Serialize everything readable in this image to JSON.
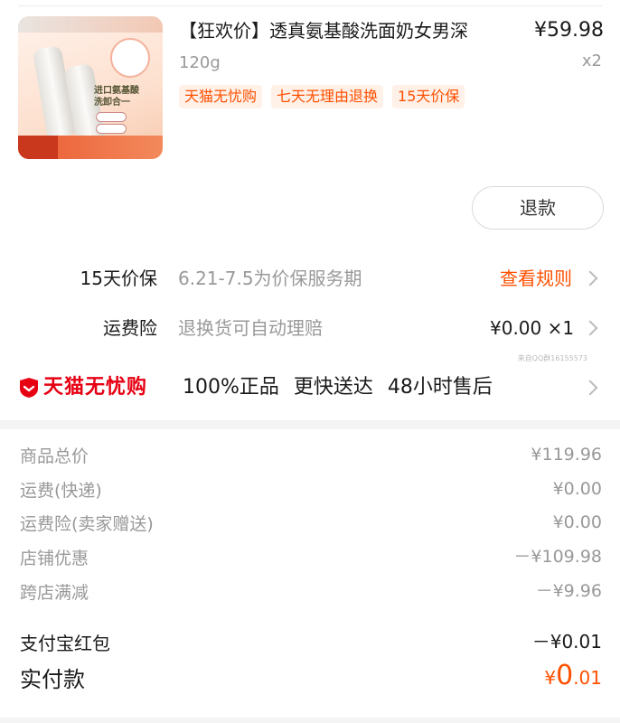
{
  "product": {
    "title": "【狂欢价】透真氨基酸洗面奶女男深",
    "price": "¥59.98",
    "spec": "120g",
    "quantity": "x2",
    "tags": [
      "天猫无忧购",
      "七天无理由退换",
      "15天价保"
    ],
    "image_text": "进口氨基酸洗卸合一"
  },
  "actions": {
    "refund_label": "退款"
  },
  "price_protect": {
    "label": "15天价保",
    "desc": "6.21-7.5为价保服务期",
    "link": "查看规则"
  },
  "shipping_insurance": {
    "label": "运费险",
    "desc": "退换货可自动理赔",
    "value": "¥0.00 ×1"
  },
  "tmall": {
    "brand": "天猫无忧购",
    "points": [
      "100%正品",
      "更快送达",
      "48小时售后"
    ]
  },
  "watermark_note": "来自QQ群16155573",
  "summary": [
    {
      "label": "商品总价",
      "value": "¥119.96"
    },
    {
      "label": "运费(快递)",
      "value": "¥0.00"
    },
    {
      "label": "运费险(卖家赠送)",
      "value": "¥0.00"
    },
    {
      "label": "店铺优惠",
      "value": "－¥109.98"
    },
    {
      "label": "跨店满减",
      "value": "－¥9.96"
    }
  ],
  "alipay_redpacket": {
    "label": "支付宝红包",
    "value": "－¥0.01"
  },
  "total": {
    "label": "实付款",
    "currency": "¥",
    "integer": "0",
    "decimal": ".01"
  },
  "colors": {
    "accent": "#ff5000",
    "tmall_red": "#e60012",
    "muted": "#999999"
  }
}
